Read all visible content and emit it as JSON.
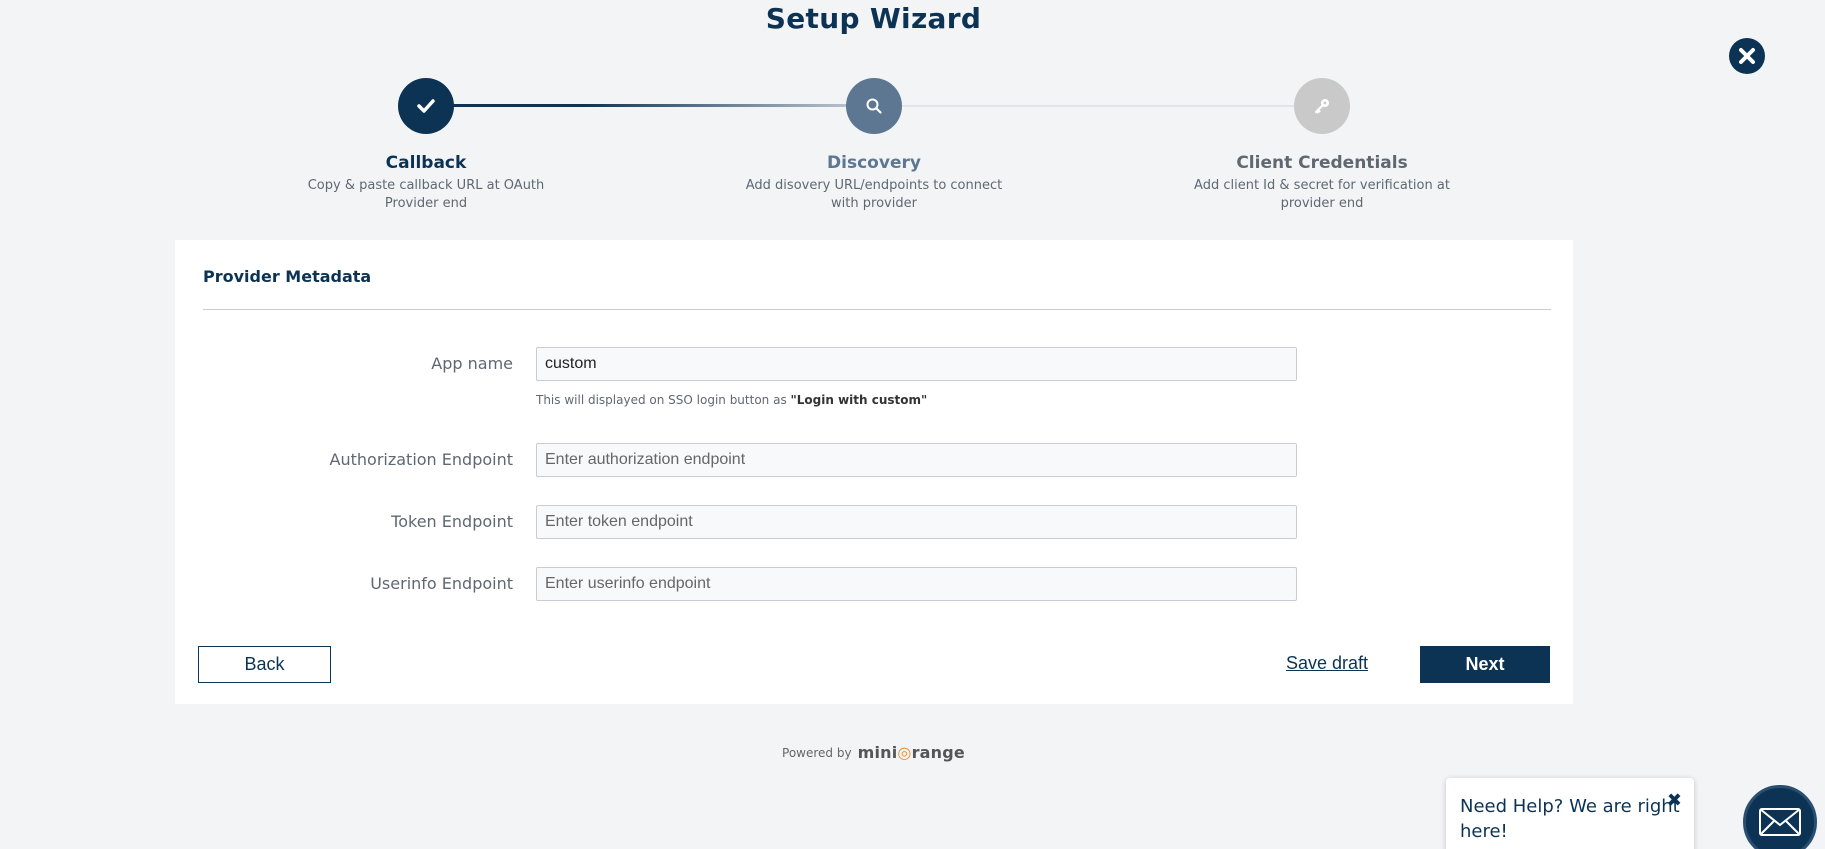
{
  "header": {
    "title": "Setup Wizard"
  },
  "steps": [
    {
      "title": "Callback",
      "description": "Copy & paste callback URL at OAuth Provider end",
      "icon": "check-icon",
      "state": "completed"
    },
    {
      "title": "Discovery",
      "description": "Add disovery URL/endpoints to connect with provider",
      "icon": "search-icon",
      "state": "active"
    },
    {
      "title": "Client Credentials",
      "description": "Add client Id & secret for verification at provider end",
      "icon": "key-icon",
      "state": "pending"
    }
  ],
  "form": {
    "section_title": "Provider Metadata",
    "app_name": {
      "label": "App name",
      "value": "custom"
    },
    "hint_prefix": "This will displayed on SSO login button as",
    "hint_value": "\"Login with custom\"",
    "authorization": {
      "label": "Authorization Endpoint",
      "placeholder": "Enter authorization endpoint"
    },
    "token": {
      "label": "Token Endpoint",
      "placeholder": "Enter token endpoint"
    },
    "userinfo": {
      "label": "Userinfo Endpoint",
      "placeholder": "Enter userinfo endpoint"
    }
  },
  "actions": {
    "back": "Back",
    "save_draft": "Save draft",
    "next": "Next"
  },
  "footer": {
    "powered_by": "Powered by",
    "brand_pre": "mini",
    "brand_post": "range"
  },
  "help": {
    "text": "Need Help? We are right here!",
    "close": "✖"
  },
  "colors": {
    "primary": "#0c3354",
    "active_step": "#5d7792",
    "pending_step": "#c9c9c9",
    "brand_accent": "#f28b20"
  }
}
